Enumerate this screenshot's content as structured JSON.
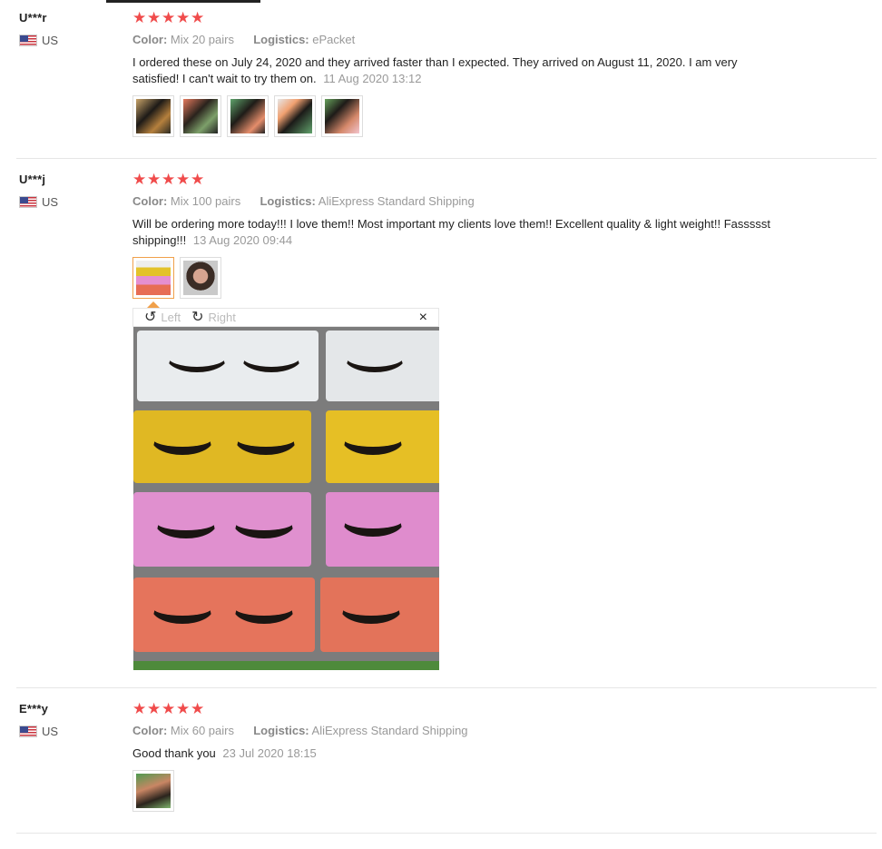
{
  "star_count_glyph": "★",
  "labels": {
    "color": "Color:",
    "logistics": "Logistics:"
  },
  "reviews": [
    {
      "user": "U***r",
      "country": "US",
      "rating": 5,
      "color_value": "Mix 20 pairs",
      "logistics_value": "ePacket",
      "text": "I ordered these on July 24, 2020 and they arrived faster than I expected. They arrived on August 11, 2020. I am very satisfied! I can't wait to try them on.",
      "date": "11 Aug 2020 13:12"
    },
    {
      "user": "U***j",
      "country": "US",
      "rating": 5,
      "color_value": "Mix 100 pairs",
      "logistics_value": "AliExpress Standard Shipping",
      "text": "Will be ordering more today!!! I love them!! Most important my clients love them!! Excellent quality & light weight!! Fassssst shipping!!!",
      "date": "13 Aug 2020 09:44"
    },
    {
      "user": "E***y",
      "country": "US",
      "rating": 5,
      "color_value": "Mix 60 pairs",
      "logistics_value": "AliExpress Standard Shipping",
      "text": "Good thank you",
      "date": "23 Jul 2020 18:15"
    }
  ],
  "viewer": {
    "rotate_left": "Left",
    "rotate_right": "Right",
    "close": "×",
    "rotate_left_icon": "↺",
    "rotate_right_icon": "↻"
  },
  "colors": {
    "star": "#f04b4b",
    "active_thumb": "#f0a04b"
  }
}
